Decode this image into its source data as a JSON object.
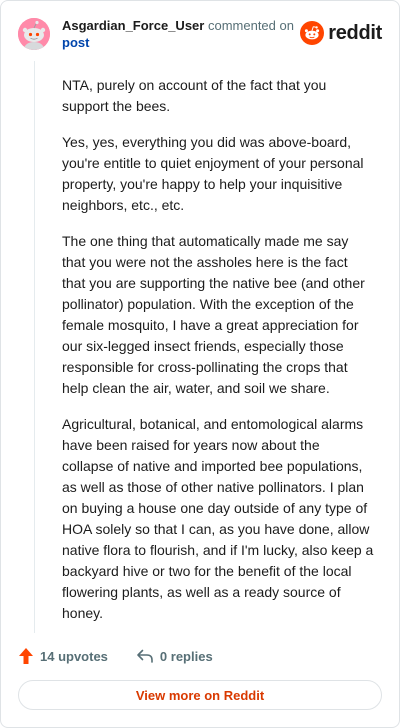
{
  "header": {
    "author": "Asgardian_Force_User",
    "commented_on": "commented on",
    "post_link": "post"
  },
  "brand": {
    "name": "reddit",
    "icon": "reddit-snoo-icon",
    "accent": "#ff4500"
  },
  "comment": {
    "paragraphs": [
      "NTA, purely on account of the fact that you support the bees.",
      "Yes, yes, everything you did was above-board, you're entitle to quiet enjoyment of your personal property, you're happy to help your inquisitive neighbors, etc., etc.",
      "The one thing that automatically made me say that you were not the assholes here is the fact that you are supporting the native bee (and other pollinator) population. With the exception of the female mosquito, I have a great appreciation for our six-legged insect friends, especially those responsible for cross-pollinating the crops that help clean the air, water, and soil we share.",
      "Agricultural, botanical, and entomological alarms have been raised for years now about the collapse of native and imported bee populations, as well as those of other native pollinators. I plan on buying a house one day outside of any type of HOA solely so that I can, as you have done, allow native flora to flourish, and if I'm lucky, also keep a backyard hive or two for the benefit of the local flowering plants, as well as a ready source of honey."
    ]
  },
  "actions": {
    "upvotes": "14 upvotes",
    "upvote_icon": "upvote-arrow-icon",
    "upvote_color": "#ff4500",
    "replies": "0 replies",
    "reply_icon": "reply-arrow-icon"
  },
  "footer": {
    "view_more": "View more on Reddit",
    "view_more_color": "#d93900"
  },
  "colors": {
    "avatar_bg": "#ff8aa9",
    "link": "#0045ac",
    "muted": "#576f76"
  }
}
